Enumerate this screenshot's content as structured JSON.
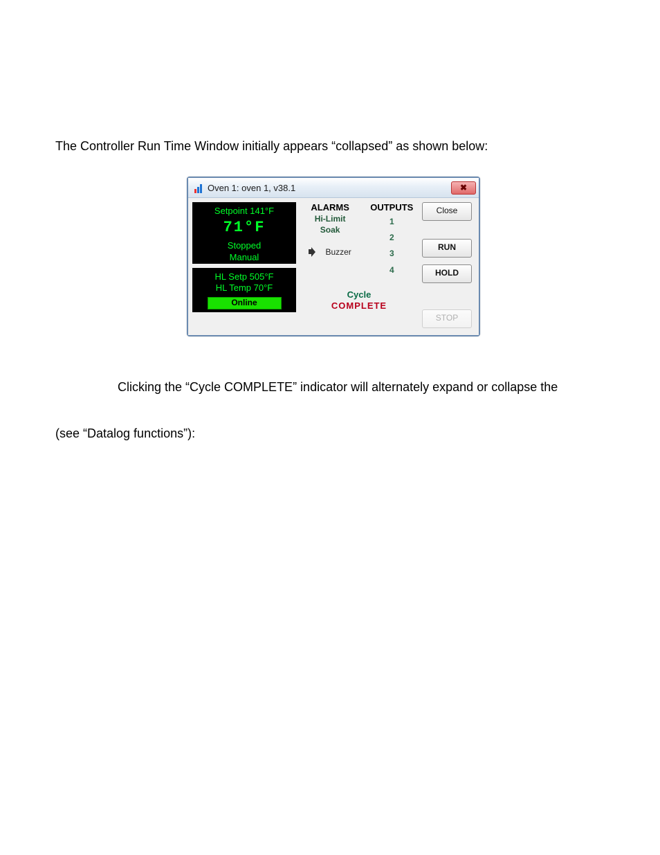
{
  "doc": {
    "para1": "The Controller Run Time Window initially appears “collapsed” as shown below:",
    "para2": "Clicking the “Cycle COMPLETE” indicator will alternately expand or collapse the",
    "para3": "(see “Datalog functions”):"
  },
  "window": {
    "title": "Oven 1: oven 1, v38.1",
    "close_x": "✖"
  },
  "status": {
    "setpoint_line": "Setpoint 141°F",
    "temp": "71°F",
    "state": "Stopped",
    "mode": "Manual",
    "hl_setp": "HL Setp 505°F",
    "hl_temp": "HL Temp 70°F",
    "online": "Online"
  },
  "alarms": {
    "header": "ALARMS",
    "hi_limit": "Hi-Limit",
    "soak": "Soak",
    "buzzer": "Buzzer"
  },
  "outputs": {
    "header": "OUTPUTS",
    "o1": "1",
    "o2": "2",
    "o3": "3",
    "o4": "4"
  },
  "cycle": {
    "line1": "Cycle",
    "line2": "COMPLETE"
  },
  "buttons": {
    "close": "Close",
    "run": "RUN",
    "hold": "HOLD",
    "stop": "STOP"
  }
}
